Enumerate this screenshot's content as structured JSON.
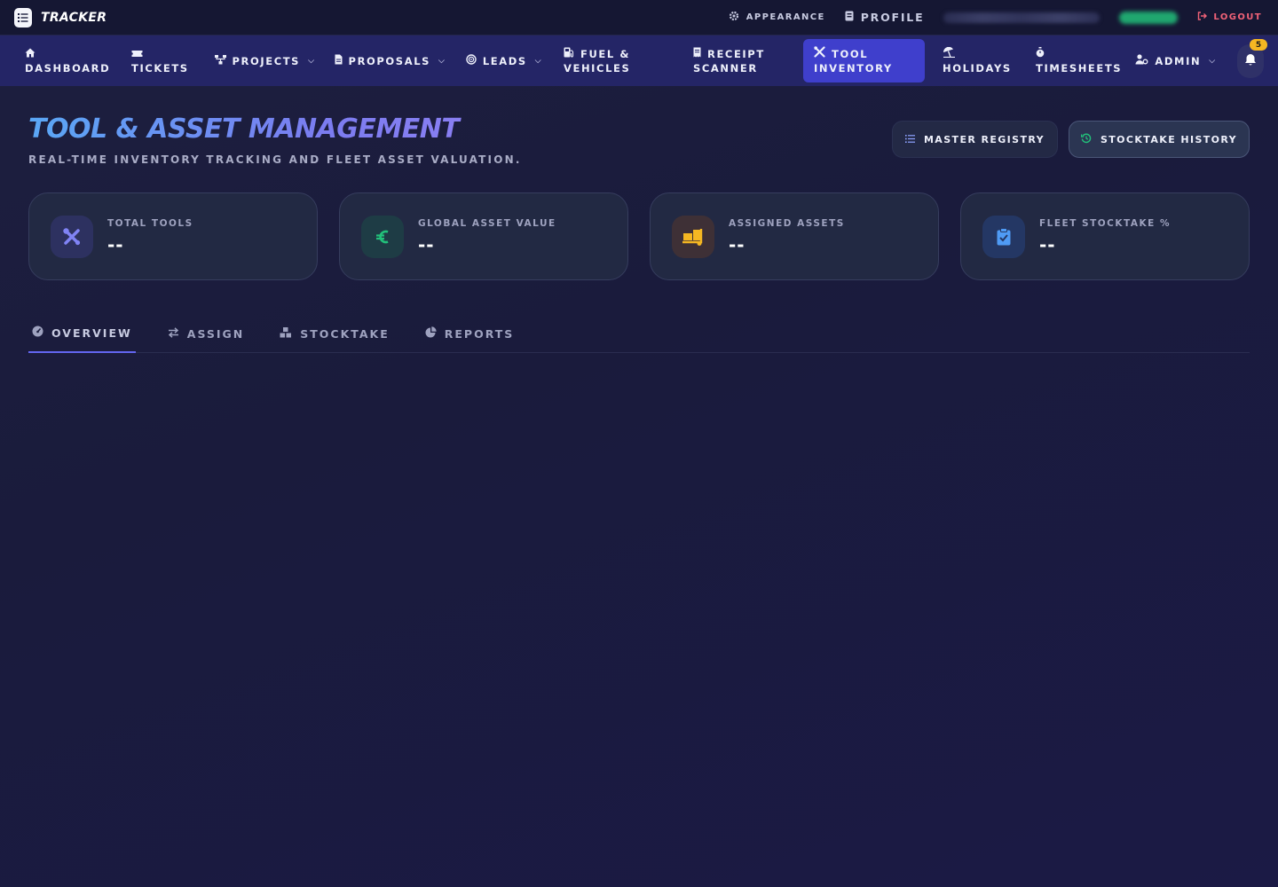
{
  "topbar": {
    "brand": "TRACKER",
    "appearance": "APPEARANCE",
    "profile": "PROFILE",
    "logout": "LOGOUT"
  },
  "nav": {
    "items": [
      {
        "label_1": "DASHBOARD",
        "icon": "home-icon"
      },
      {
        "label_1": "TICKETS",
        "icon": "ticket-icon"
      },
      {
        "label_1": "PROJECTS",
        "icon": "sitemap-icon"
      },
      {
        "label_1": "PROPOSALS",
        "icon": "file-icon"
      },
      {
        "label_1": "LEADS",
        "icon": "target-icon"
      },
      {
        "label_1": "FUEL &",
        "label_2": "VEHICLES",
        "icon": "fuel-icon"
      },
      {
        "label_1": "RECEIPT",
        "label_2": "SCANNER",
        "icon": "receipt-icon"
      },
      {
        "label_1": "TOOL",
        "label_2": "INVENTORY",
        "icon": "tools-icon"
      },
      {
        "label_1": "HOLIDAYS",
        "icon": "umbrella-beach-icon"
      },
      {
        "label_1": "TIMESHEETS",
        "icon": "stopwatch-icon"
      },
      {
        "label_1": "ADMIN",
        "icon": "user-gear-icon"
      }
    ],
    "active": "TOOL INVENTORY",
    "notification_count": "5"
  },
  "page": {
    "title": "TOOL & ASSET MANAGEMENT",
    "subtitle": "REAL-TIME INVENTORY TRACKING AND FLEET ASSET VALUATION.",
    "btn_registry": "MASTER REGISTRY",
    "btn_history": "STOCKTAKE HISTORY"
  },
  "stats": [
    {
      "label": "TOTAL TOOLS",
      "value": "--",
      "icon": "tools-icon",
      "color": "#7b7cf0"
    },
    {
      "label": "GLOBAL ASSET VALUE",
      "value": "--",
      "icon": "euro-icon",
      "color": "#22c07a"
    },
    {
      "label": "ASSIGNED ASSETS",
      "value": "--",
      "icon": "dolly-icon",
      "color": "#f5b722"
    },
    {
      "label": "FLEET STOCKTAKE %",
      "value": "--",
      "icon": "clipboard-check-icon",
      "color": "#4f9bf5"
    }
  ],
  "tabs": [
    {
      "label": "OVERVIEW",
      "icon": "gauge-icon"
    },
    {
      "label": "ASSIGN",
      "icon": "exchange-icon"
    },
    {
      "label": "STOCKTAKE",
      "icon": "boxes-icon"
    },
    {
      "label": "REPORTS",
      "icon": "pie-chart-icon"
    }
  ],
  "active_tab": "OVERVIEW"
}
